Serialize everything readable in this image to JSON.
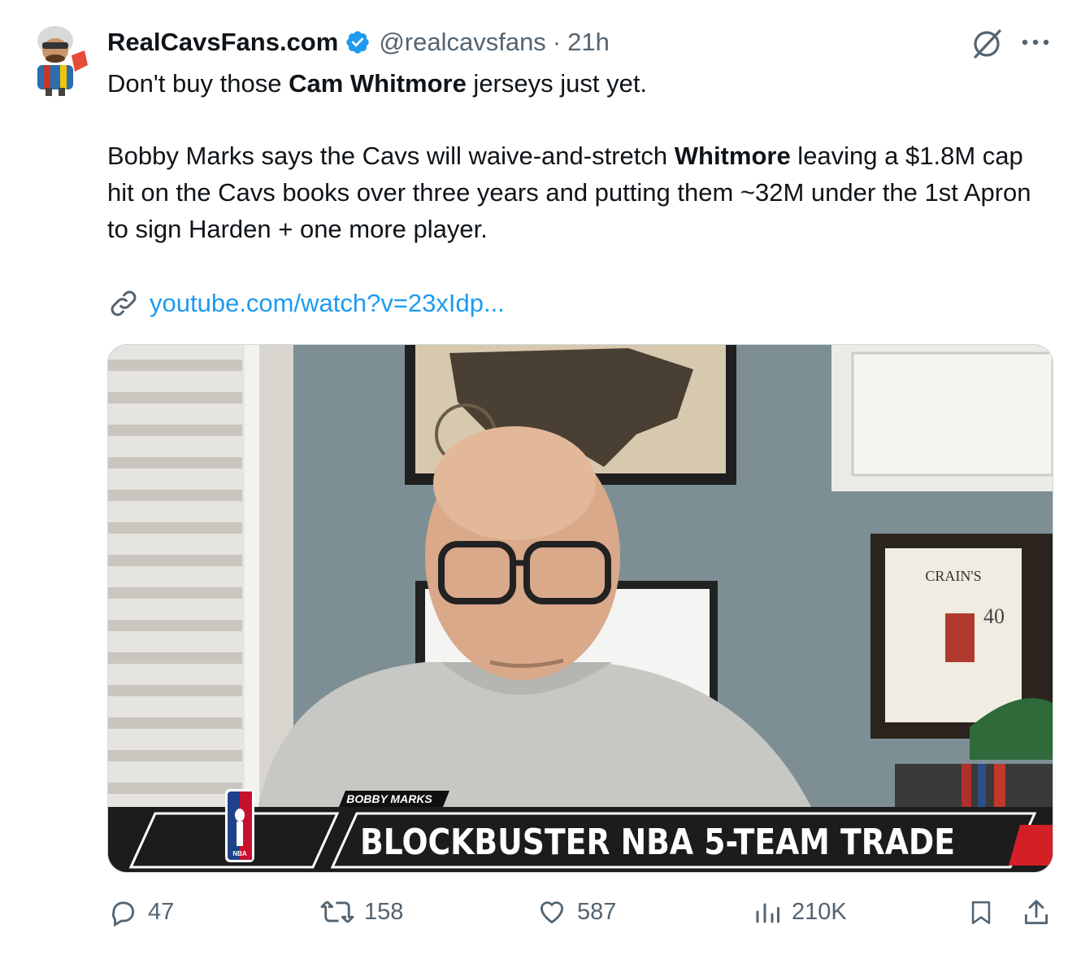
{
  "tweet": {
    "author_name": "RealCavsFans.com",
    "handle": "@realcavsfans",
    "separator": "·",
    "time": "21h",
    "text_line1_pre": "Don't buy those ",
    "text_line1_bold": "Cam Whitmore",
    "text_line1_post": " jerseys just yet.",
    "text_para2_pre": "Bobby Marks says the Cavs will waive-and-stretch ",
    "text_para2_bold": "Whitmore",
    "text_para2_post": " leaving a $1.8M cap hit on the Cavs books over three years and putting them ~32M under the 1st Apron to sign Harden + one more player.",
    "link_text": "youtube.com/watch?v=23xIdp..."
  },
  "video": {
    "lower_third_name": "BOBBY MARKS",
    "banner_text": "BLOCKBUSTER NBA 5-TEAM TRADE",
    "logo_text": "NBA",
    "frame_text": "CRAIN'S",
    "frame_number": "40"
  },
  "actions": {
    "replies": "47",
    "reposts": "158",
    "likes": "587",
    "views": "210K"
  },
  "icons": [
    "verified-badge-icon",
    "grok-icon",
    "more-icon",
    "link-icon",
    "reply-icon",
    "repost-icon",
    "like-icon",
    "views-icon",
    "bookmark-icon",
    "share-icon"
  ],
  "colors": {
    "accent": "#1d9bf0",
    "muted": "#536471",
    "text": "#0f1419"
  }
}
